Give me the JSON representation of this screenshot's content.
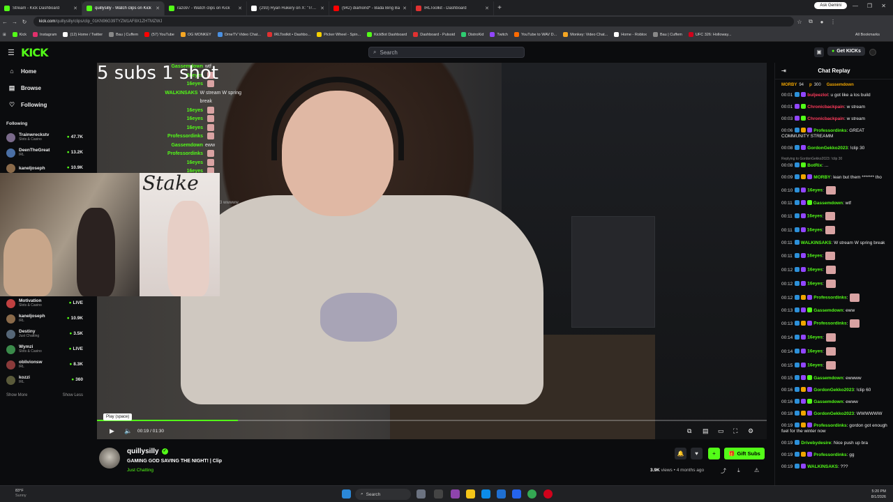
{
  "browser": {
    "tabs": [
      {
        "label": "Stream - Kick Dashboard",
        "color": "#53fc18",
        "active": false
      },
      {
        "label": "quillysilly - Watch clips on Kick",
        "color": "#53fc18",
        "active": true
      },
      {
        "label": "razo97 - Watch clips on Kick",
        "color": "#53fc18",
        "active": false
      },
      {
        "label": "(293) Ryan Hukery on X: \"Treyt",
        "color": "#ffffff",
        "active": false
      },
      {
        "label": "(942) diamond* - Bada Bing Ba",
        "color": "#ff0000",
        "active": false
      },
      {
        "label": "IRLToolkit - Dashboard",
        "color": "#e03131",
        "active": false
      }
    ],
    "gemini_label": "Ask Gemini",
    "url_host": "kick.com",
    "url_path": "/quillysilly/clips/clip_01KN96G39TYZM1AF8X1ZHTMZWJ",
    "bookmarks": [
      {
        "label": "Kick",
        "color": "#53fc18"
      },
      {
        "label": "Instagram",
        "color": "#e1306c"
      },
      {
        "label": "(12) Home / Twitter",
        "color": "#ffffff"
      },
      {
        "label": "Bau | Cuffem",
        "color": "#888888"
      },
      {
        "label": "(57) YouTube",
        "color": "#ff0000"
      },
      {
        "label": "OG MONKEY",
        "color": "#f5a623"
      },
      {
        "label": "OmeTV Video Chat...",
        "color": "#4a90e2"
      },
      {
        "label": "IRLToolkit • Dashbo...",
        "color": "#e03131"
      },
      {
        "label": "Picker Wheel - Spin...",
        "color": "#f5d000"
      },
      {
        "label": "KickBot Dashboard",
        "color": "#53fc18"
      },
      {
        "label": "Dashboard - Pulsoid",
        "color": "#e03131"
      },
      {
        "label": "DistroKid",
        "color": "#2ecc71"
      },
      {
        "label": "Twitch",
        "color": "#9146ff"
      },
      {
        "label": "YouTube to WAV D...",
        "color": "#ff6b00"
      },
      {
        "label": "Monkey: Video Chat...",
        "color": "#f5a623"
      },
      {
        "label": "Home - Roblox",
        "color": "#ffffff"
      },
      {
        "label": "Bau | Cuffem",
        "color": "#888888"
      },
      {
        "label": "UFC 326: Holloway...",
        "color": "#d0021b"
      }
    ],
    "all_bookmarks": "All Bookmarks"
  },
  "kick": {
    "logo": "KICK",
    "search_placeholder": "Search",
    "get_kicks": "Get KICKs",
    "accent": "#53fc18"
  },
  "sidebar": {
    "nav": [
      {
        "label": "Home",
        "icon": "home-icon",
        "glyph": "⌂"
      },
      {
        "label": "Browse",
        "icon": "browse-icon",
        "glyph": "▤"
      },
      {
        "label": "Following",
        "icon": "heart-icon",
        "glyph": "♡"
      }
    ],
    "following_header": "Following",
    "channels_top": [
      {
        "name": "Trainwreckstv",
        "category": "Slots & Casino",
        "viewers": "47.7K",
        "color": "#7a6a8a"
      },
      {
        "name": "DeenTheGreat",
        "category": "IRL",
        "viewers": "13.2K",
        "color": "#4a6fa5"
      },
      {
        "name": "kaneljoseph",
        "category": "",
        "viewers": "10.9K",
        "color": "#8a6a4a"
      }
    ],
    "channels_bottom": [
      {
        "name": "Motivation",
        "category": "Slots & Casino",
        "viewers": "LIVE",
        "color": "#c04040"
      },
      {
        "name": "kaneljoseph",
        "category": "IRL",
        "viewers": "10.9K",
        "color": "#8a6a4a"
      },
      {
        "name": "Destiny",
        "category": "Just Chatting",
        "viewers": "3.5K",
        "color": "#556677"
      },
      {
        "name": "Wymzi",
        "category": "Slots & Casino",
        "viewers": "LIVE",
        "color": "#3a8a4a"
      },
      {
        "name": "oblivionsw",
        "category": "IRL",
        "viewers": "8.3K",
        "color": "#8a3a3a"
      },
      {
        "name": "kozzi",
        "category": "IRL",
        "viewers": "360",
        "color": "#5a5a3a"
      }
    ],
    "show_more": "Show More",
    "show_less": "Show Less"
  },
  "video": {
    "overlay_title": "5 subs 1 shot",
    "overlay_chat": [
      {
        "name": "Gassemdown",
        "msg": "wtf",
        "color": "#53fc18",
        "emote": false
      },
      {
        "name": "16eyes",
        "msg": "",
        "color": "#53fc18",
        "emote": true
      },
      {
        "name": "16eyes",
        "msg": "",
        "color": "#53fc18",
        "emote": true
      },
      {
        "name": "WALKINSAKS",
        "msg": "W stream W spring break",
        "color": "#53fc18",
        "emote": false
      },
      {
        "name": "16eyes",
        "msg": "",
        "color": "#53fc18",
        "emote": true
      },
      {
        "name": "16eyes",
        "msg": "",
        "color": "#53fc18",
        "emote": true
      },
      {
        "name": "16eyes",
        "msg": "",
        "color": "#53fc18",
        "emote": true
      },
      {
        "name": "Professordinks",
        "msg": "",
        "color": "#53fc18",
        "emote": true
      },
      {
        "name": "Gassemdown",
        "msg": "eww",
        "color": "#53fc18",
        "emote": false
      },
      {
        "name": "Professordinks",
        "msg": "",
        "color": "#53fc18",
        "emote": true
      },
      {
        "name": "16eyes",
        "msg": "",
        "color": "#53fc18",
        "emote": true
      },
      {
        "name": "16eyes",
        "msg": "",
        "color": "#53fc18",
        "emote": true
      },
      {
        "name": "16eyes",
        "msg": "",
        "color": "#53fc18",
        "emote": true
      }
    ],
    "cam_overlay_text": "Stake",
    "cam_caption": "3 wwwww",
    "tooltip": "Play (space)",
    "time_current": "00:19",
    "time_total": "01:30",
    "progress_fraction": 0.21
  },
  "clip": {
    "streamer": "quillysilly",
    "title": "GAMING GOD SAVING THE NIGHT! | Clip",
    "category": "Just Chatting",
    "views": "3.9K",
    "views_label": "views",
    "age": "4 months ago",
    "gift_label": "Gift Subs"
  },
  "chat": {
    "title": "Chat Replay",
    "leaderboard": [
      {
        "name": "MORBY",
        "value": "94"
      },
      {
        "name": "p",
        "value": "300"
      },
      {
        "name": "Gassemdown",
        "value": ""
      }
    ],
    "messages": [
      {
        "ts": "00:01",
        "user": "buljeezlol",
        "color": "#ff3b5c",
        "text": ": u got like a los build",
        "badges": [
          "#2c90d9",
          "#9146ff"
        ]
      },
      {
        "ts": "00:01",
        "user": "Chronicbackpain",
        "color": "#ff3b5c",
        "text": ": w stream",
        "badges": [
          "#9146ff",
          "#53fc18"
        ]
      },
      {
        "ts": "00:03",
        "user": "Chronicbackpain",
        "color": "#ff3b5c",
        "text": ": w stream",
        "badges": [
          "#9146ff",
          "#53fc18"
        ]
      },
      {
        "ts": "00:06",
        "user": "Professordinks",
        "color": "#53fc18",
        "text": ": GREAT COMMUNITY STREAMM",
        "badges": [
          "#2c90d9",
          "#f0a500",
          "#9146ff"
        ]
      },
      {
        "ts": "00:08",
        "user": "GordonGekko2023",
        "color": "#53fc18",
        "text": ": !clip 30",
        "badges": [
          "#2c90d9",
          "#9146ff"
        ]
      },
      {
        "reply": "Replying to GordonGekko2023: !clip 30"
      },
      {
        "ts": "00:08",
        "user": "BotRix",
        "color": "#53fc18",
        "text": ": ...",
        "badges": [
          "#2c90d9",
          "#53fc18"
        ]
      },
      {
        "ts": "00:09",
        "user": "MORBY",
        "color": "#53fc18",
        "text": ": lean but them ******* tho",
        "badges": [
          "#2c90d9",
          "#f0a500",
          "#9146ff"
        ]
      },
      {
        "ts": "00:10",
        "user": "16eyes",
        "color": "#53fc18",
        "text": ":",
        "badges": [
          "#2c90d9",
          "#9146ff"
        ],
        "emote": true
      },
      {
        "ts": "00:11",
        "user": "Gassemdown",
        "color": "#53fc18",
        "text": ": wtf",
        "badges": [
          "#2c90d9",
          "#9146ff",
          "#53fc18"
        ]
      },
      {
        "ts": "00:11",
        "user": "16eyes",
        "color": "#53fc18",
        "text": ":",
        "badges": [
          "#2c90d9",
          "#9146ff"
        ],
        "emote": true
      },
      {
        "ts": "00:11",
        "user": "16eyes",
        "color": "#53fc18",
        "text": ":",
        "badges": [
          "#2c90d9",
          "#9146ff"
        ],
        "emote": true
      },
      {
        "ts": "00:11",
        "user": "WALKINSAKS",
        "color": "#53fc18",
        "text": ": W stream W spring break",
        "badges": [
          "#2c90d9"
        ]
      },
      {
        "ts": "00:11",
        "user": "16eyes",
        "color": "#53fc18",
        "text": ":",
        "badges": [
          "#2c90d9",
          "#9146ff"
        ],
        "emote": true
      },
      {
        "ts": "00:12",
        "user": "16eyes",
        "color": "#53fc18",
        "text": ":",
        "badges": [
          "#2c90d9",
          "#9146ff"
        ],
        "emote": true
      },
      {
        "ts": "00:12",
        "user": "16eyes",
        "color": "#53fc18",
        "text": ":",
        "badges": [
          "#2c90d9",
          "#9146ff"
        ],
        "emote": true
      },
      {
        "ts": "00:12",
        "user": "Professordinks",
        "color": "#53fc18",
        "text": ":",
        "badges": [
          "#2c90d9",
          "#f0a500",
          "#9146ff"
        ],
        "emote": true
      },
      {
        "ts": "00:13",
        "user": "Gassemdown",
        "color": "#53fc18",
        "text": ": eww",
        "badges": [
          "#2c90d9",
          "#9146ff",
          "#53fc18"
        ]
      },
      {
        "ts": "00:13",
        "user": "Professordinks",
        "color": "#53fc18",
        "text": ":",
        "badges": [
          "#2c90d9",
          "#f0a500",
          "#9146ff"
        ],
        "emote": true
      },
      {
        "ts": "00:14",
        "user": "16eyes",
        "color": "#53fc18",
        "text": ":",
        "badges": [
          "#2c90d9",
          "#9146ff"
        ],
        "emote": true
      },
      {
        "ts": "00:14",
        "user": "16eyes",
        "color": "#53fc18",
        "text": ":",
        "badges": [
          "#2c90d9",
          "#9146ff"
        ],
        "emote": true
      },
      {
        "ts": "00:15",
        "user": "16eyes",
        "color": "#53fc18",
        "text": ":",
        "badges": [
          "#2c90d9",
          "#9146ff"
        ],
        "emote": true
      },
      {
        "ts": "00:15",
        "user": "Gassemdown",
        "color": "#53fc18",
        "text": ": ewwww",
        "badges": [
          "#2c90d9",
          "#9146ff",
          "#53fc18"
        ]
      },
      {
        "ts": "00:16",
        "user": "GordonGekko2023",
        "color": "#53fc18",
        "text": ": !clip 60",
        "badges": [
          "#2c90d9",
          "#f0a500",
          "#9146ff"
        ]
      },
      {
        "ts": "00:16",
        "user": "Gassemdown",
        "color": "#53fc18",
        "text": ": ewww",
        "badges": [
          "#2c90d9",
          "#9146ff",
          "#53fc18"
        ]
      },
      {
        "ts": "00:18",
        "user": "GordonGekko2023",
        "color": "#53fc18",
        "text": ": WWWWWW",
        "badges": [
          "#2c90d9",
          "#f0a500",
          "#9146ff"
        ]
      },
      {
        "ts": "00:19",
        "user": "Professordinks",
        "color": "#53fc18",
        "text": ": gordon got enough fuel for the winter now",
        "badges": [
          "#2c90d9",
          "#f0a500",
          "#9146ff"
        ]
      },
      {
        "ts": "00:19",
        "user": "Drivebydesire",
        "color": "#53fc18",
        "text": ": Nice push up bra",
        "badges": [
          "#2c90d9"
        ]
      },
      {
        "ts": "00:19",
        "user": "Professordinks",
        "color": "#53fc18",
        "text": ": gg",
        "badges": [
          "#2c90d9",
          "#f0a500",
          "#9146ff"
        ]
      },
      {
        "ts": "00:19",
        "user": "WALKINSAKS",
        "color": "#53fc18",
        "text": ": ???",
        "badges": [
          "#2c90d9",
          "#9146ff"
        ]
      }
    ]
  },
  "taskbar": {
    "weather_temp": "83°F",
    "weather_desc": "Sunny",
    "search": "Search",
    "time": "5:20 PM",
    "date": "8/1/2026"
  }
}
